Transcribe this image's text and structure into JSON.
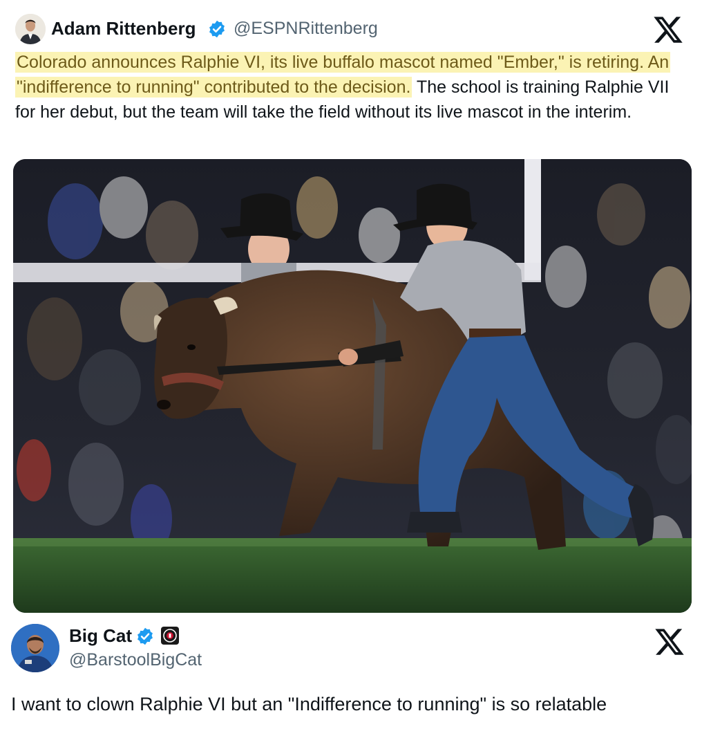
{
  "tweet1": {
    "author_name": "Adam Rittenberg",
    "author_handle": "@ESPNRittenberg",
    "verified": true,
    "text_highlighted": "Colorado announces Ralphie VI, its live buffalo mascot named \"Ember,\" is retiring. An \"indifference to running\" contributed to the decision.",
    "text_rest": " The school is training Ralphie VII for her debut, but the team will take the field without its live mascot in the interim.",
    "highlight_color": "#fbf3b4",
    "photo_icon": "buffalo-mascot-run-photo"
  },
  "tweet2": {
    "author_name": "Big Cat",
    "author_handle": "@BarstoolBigCat",
    "verified": true,
    "affiliate_badge_icon": "barstool-badge-icon",
    "text": "I want to clown Ralphie VI but an \"Indifference to running\" is so relatable"
  },
  "colors": {
    "verified_blue": "#1d9bf0",
    "handle_gray": "#536471",
    "text": "#0f1419"
  },
  "icons": {
    "platform_logo": "x-logo-icon",
    "verified": "verified-badge-icon"
  }
}
